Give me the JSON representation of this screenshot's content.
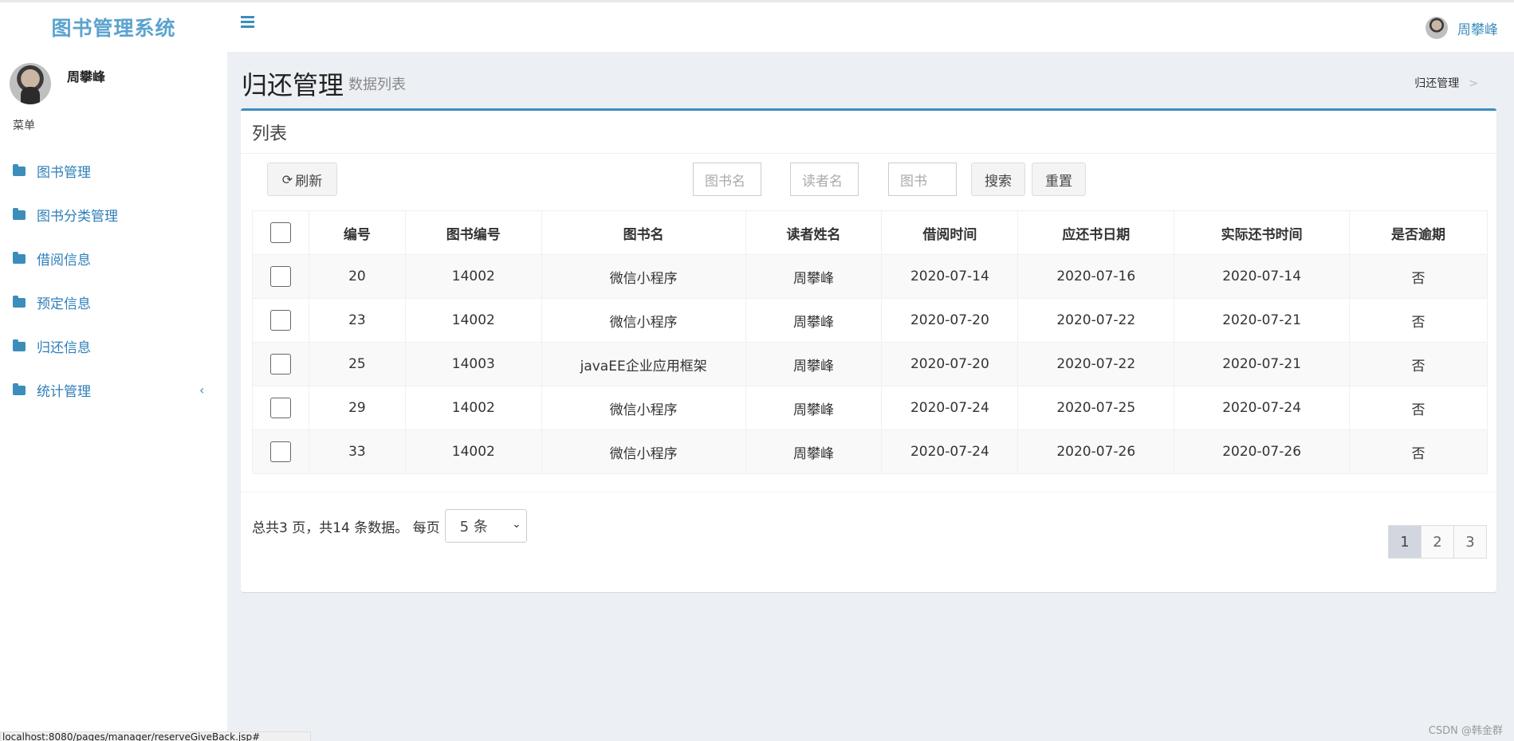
{
  "app": {
    "brand": "图书管理系统",
    "user_name": "周攀峰"
  },
  "sidebar": {
    "menu_header": "菜单",
    "items": [
      {
        "label": "图书管理"
      },
      {
        "label": "图书分类管理"
      },
      {
        "label": "借阅信息"
      },
      {
        "label": "预定信息"
      },
      {
        "label": "归还信息"
      },
      {
        "label": "统计管理",
        "chevron": "‹"
      }
    ]
  },
  "page": {
    "title": "归还管理",
    "subtitle": "数据列表",
    "breadcrumb": "归还管理",
    "breadcrumb_sep": ">"
  },
  "box": {
    "title": "列表",
    "refresh_label": "刷新",
    "search_placeholders": [
      "图书名",
      "读者名",
      "图书"
    ],
    "search_label": "搜索",
    "reset_label": "重置"
  },
  "table": {
    "headers": [
      "编号",
      "图书编号",
      "图书名",
      "读者姓名",
      "借阅时间",
      "应还书日期",
      "实际还书时间",
      "是否逾期"
    ],
    "rows": [
      [
        "20",
        "14002",
        "微信小程序",
        "周攀峰",
        "2020-07-14",
        "2020-07-16",
        "2020-07-14",
        "否"
      ],
      [
        "23",
        "14002",
        "微信小程序",
        "周攀峰",
        "2020-07-20",
        "2020-07-22",
        "2020-07-21",
        "否"
      ],
      [
        "25",
        "14003",
        "javaEE企业应用框架",
        "周攀峰",
        "2020-07-20",
        "2020-07-22",
        "2020-07-21",
        "否"
      ],
      [
        "29",
        "14002",
        "微信小程序",
        "周攀峰",
        "2020-07-24",
        "2020-07-25",
        "2020-07-24",
        "否"
      ],
      [
        "33",
        "14002",
        "微信小程序",
        "周攀峰",
        "2020-07-24",
        "2020-07-26",
        "2020-07-26",
        "否"
      ]
    ]
  },
  "pagination": {
    "info": "总共3 页，共14 条数据。 每页",
    "page_size": "5 条",
    "pages": [
      "1",
      "2",
      "3"
    ],
    "current": "1"
  },
  "statusbar": {
    "url": "localhost:8080/pages/manager/reserveGiveBack.jsp#"
  },
  "watermark": "CSDN @韩金群"
}
